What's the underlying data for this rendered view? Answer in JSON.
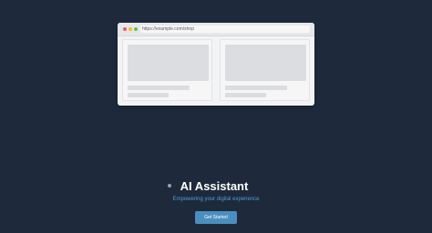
{
  "browser": {
    "url": "https://example.com/shop"
  },
  "hero": {
    "title": "AI Assistant",
    "subtitle": "Empowering your digital experience",
    "cta_label": "Get Started"
  },
  "icons": {
    "title_icon": "sparkle-dot-icon"
  },
  "colors": {
    "background": "#1e2a3b",
    "accent": "#4a8fbf",
    "subtitle": "#4d9ed3"
  }
}
